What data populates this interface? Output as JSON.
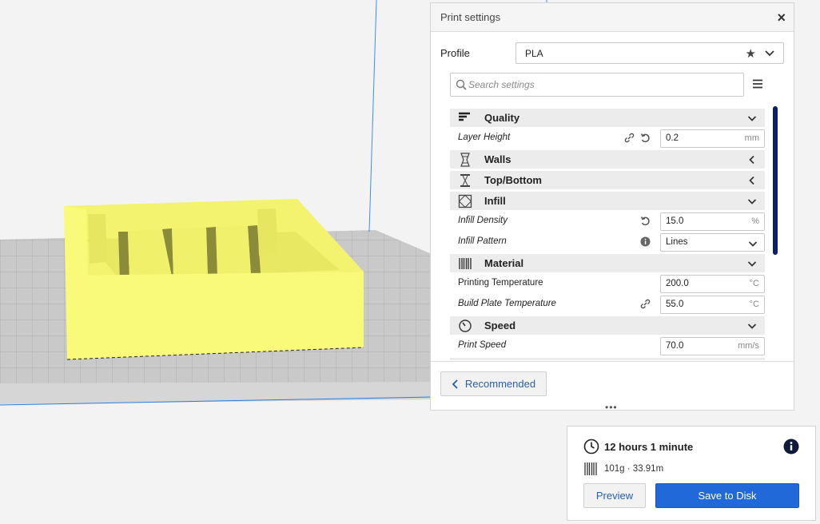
{
  "panel": {
    "title": "Print settings",
    "close_icon": "×",
    "profile_label": "Profile",
    "profile_value": "PLA",
    "search_placeholder": "Search settings",
    "recommended_label": "Recommended",
    "resize_handle": "•••"
  },
  "categories": [
    {
      "label": "Quality",
      "icon": "quality-icon"
    },
    {
      "label": "Walls",
      "icon": "walls-icon"
    },
    {
      "label": "Top/Bottom",
      "icon": "top-bottom-icon"
    },
    {
      "label": "Infill",
      "icon": "infill-icon"
    },
    {
      "label": "Material",
      "icon": "material-icon"
    },
    {
      "label": "Speed",
      "icon": "speed-icon"
    }
  ],
  "settings": [
    {
      "label": "Layer Height",
      "value": "0.2",
      "unit": "mm"
    },
    {
      "label": "Infill Density",
      "value": "15.0",
      "unit": "%"
    },
    {
      "label": "Infill Pattern",
      "value": "Lines"
    },
    {
      "label": "Printing Temperature",
      "value": "200.0",
      "unit": "°C"
    },
    {
      "label": "Build Plate Temperature",
      "value": "55.0",
      "unit": "°C"
    },
    {
      "label": "Print Speed",
      "value": "70.0",
      "unit": "mm/s"
    }
  ],
  "job": {
    "time": "12 hours 1 minute",
    "filament": "101g · 33.91m",
    "preview_label": "Preview",
    "save_label": "Save to Disk"
  },
  "colors": {
    "model": "#fafa7a",
    "accent": "#2168d9",
    "scrollbar": "#0a1f6b"
  }
}
